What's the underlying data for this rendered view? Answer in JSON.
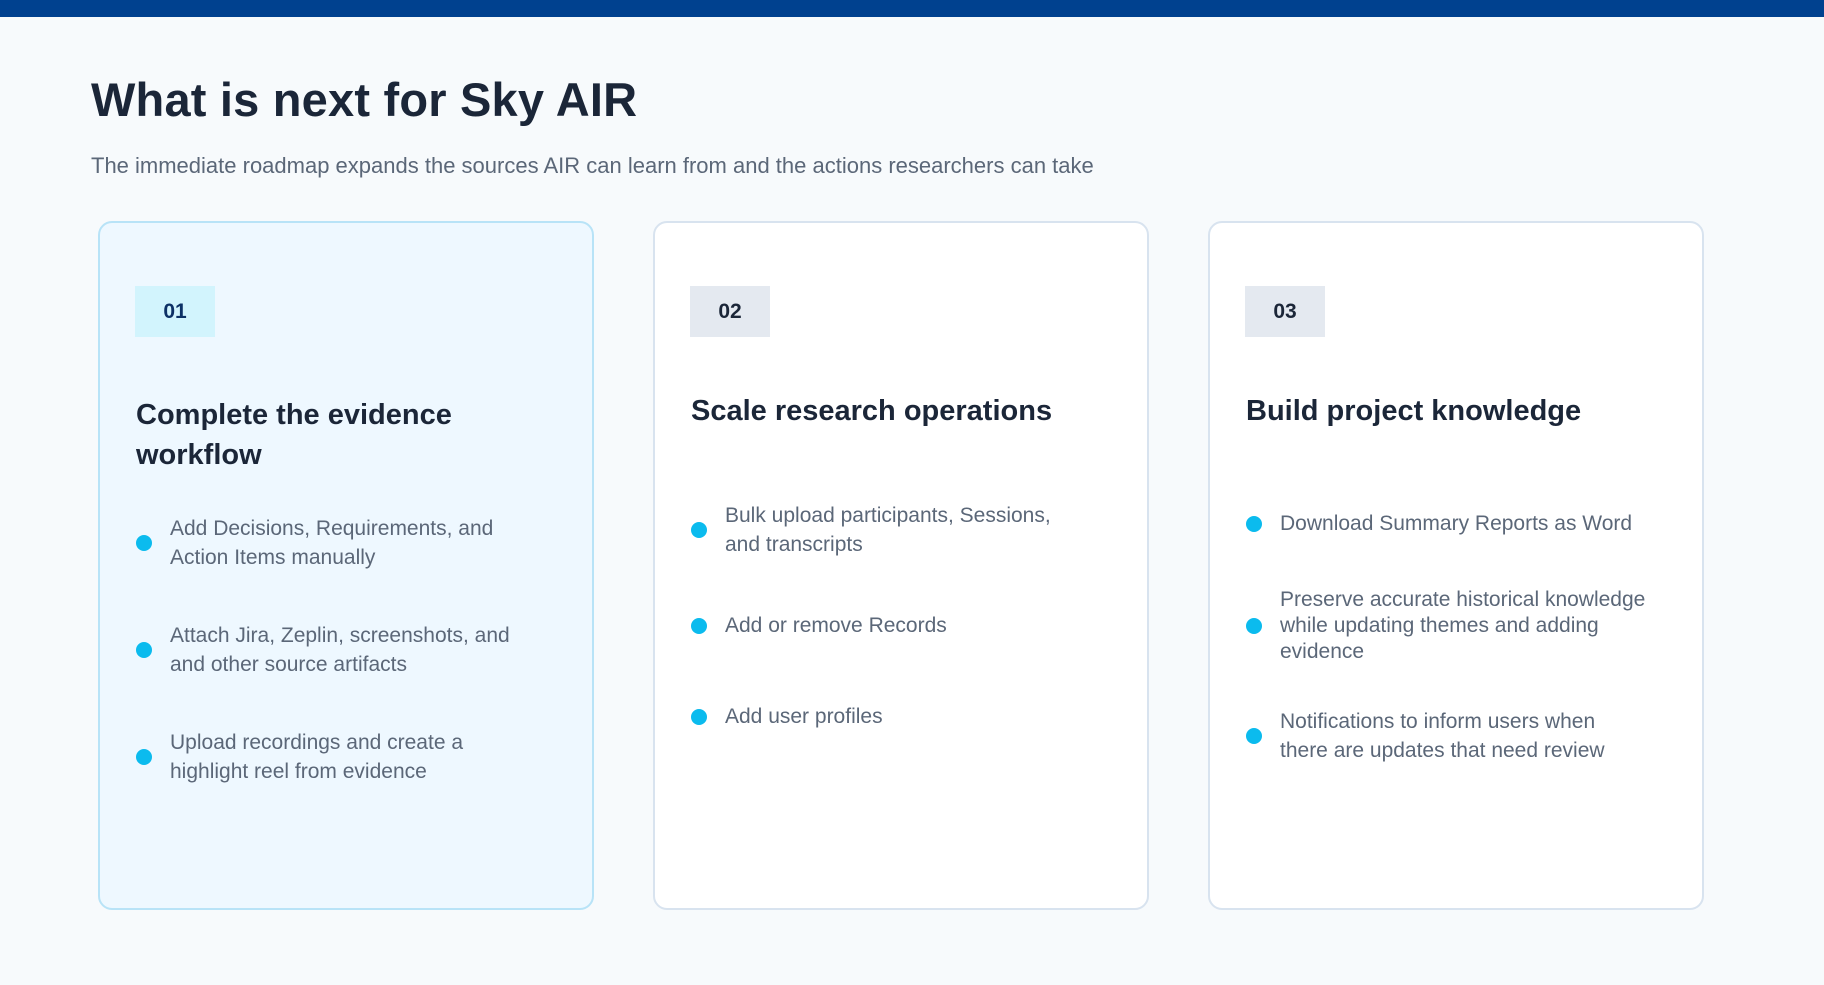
{
  "header": {
    "title": "What is next for Sky AIR",
    "subtitle": "The immediate roadmap expands the sources AIR can learn from and the actions researchers can take"
  },
  "colors": {
    "top_bar": "#00418f",
    "accent_dot": "#0bbbee",
    "active_card_bg": "#eef8ff",
    "active_badge_bg": "#d2f4fd",
    "badge_bg": "#e4e9f0",
    "title_text": "#1b2638",
    "body_text": "#5b6778"
  },
  "cards": [
    {
      "number": "01",
      "title": "Complete the evidence workflow",
      "active": true,
      "items": [
        "Add Decisions, Requirements, and Action Items manually",
        "Attach Jira, Zeplin, screenshots, and and other source artifacts",
        "Upload recordings and create a highlight reel from evidence"
      ]
    },
    {
      "number": "02",
      "title": "Scale research operations",
      "active": false,
      "items": [
        "Bulk upload participants, Sessions, and transcripts",
        "Add or remove Records",
        "Add user profiles"
      ]
    },
    {
      "number": "03",
      "title": "Build project knowledge",
      "active": false,
      "items": [
        "Download Summary Reports as Word",
        "Preserve accurate historical knowledge while updating themes and adding evidence",
        "Notifications to inform users when there are updates that need review"
      ]
    }
  ]
}
